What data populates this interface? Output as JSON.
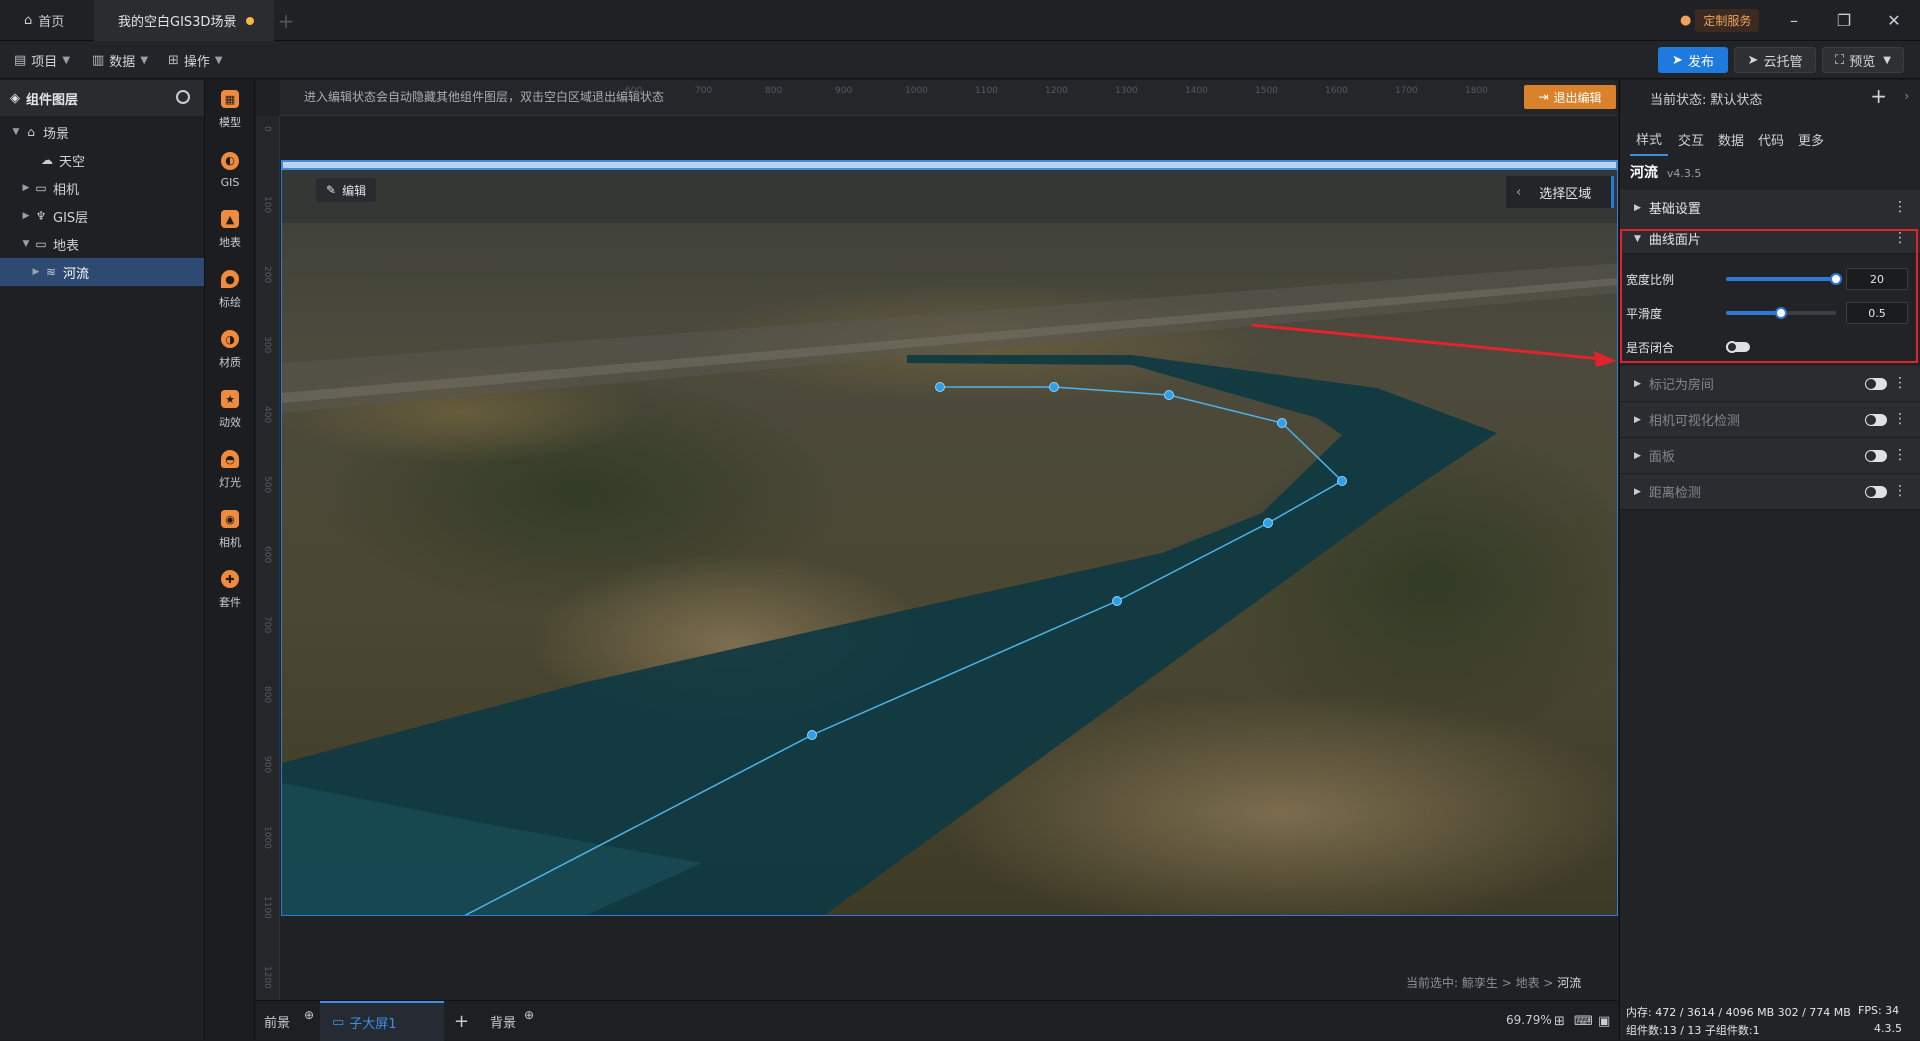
{
  "titlebar": {
    "home_tab": "首页",
    "scene_tab": "我的空白GIS3D场景",
    "custom_service": "定制服务"
  },
  "menubar": {
    "project": "项目",
    "data": "数据",
    "operate": "操作",
    "publish": "发布",
    "cloud": "云托管",
    "preview": "预览"
  },
  "layers": {
    "title": "组件图层",
    "items": [
      {
        "label": "场景"
      },
      {
        "label": "天空"
      },
      {
        "label": "相机"
      },
      {
        "label": "GIS层"
      },
      {
        "label": "地表"
      },
      {
        "label": "河流"
      }
    ]
  },
  "toolbox": {
    "items": [
      "模型",
      "GIS",
      "地表",
      "标绘",
      "材质",
      "动效",
      "灯光",
      "相机",
      "套件"
    ]
  },
  "canvas": {
    "notice": "进入编辑状态会自动隐藏其他组件图层，双击空白区域退出编辑状态",
    "exit_edit": "退出编辑",
    "edit_chip": "编辑",
    "select_area": "选择区域",
    "ruler_top": [
      "600",
      "700",
      "800",
      "900",
      "1000",
      "1100",
      "1200",
      "1300",
      "1400",
      "1500",
      "1600",
      "1700",
      "1800"
    ],
    "ruler_left": [
      "0",
      "100",
      "200",
      "300",
      "400",
      "500",
      "600",
      "700",
      "800",
      "900",
      "1000",
      "1100",
      "1200"
    ],
    "breadcrumb_prefix": "当前选中:",
    "breadcrumb": [
      "鲸孪生",
      "地表",
      "河流"
    ]
  },
  "bottombar": {
    "front": "前景",
    "sub_screen": "子大屏1",
    "background": "背景",
    "zoom": "69.79%"
  },
  "right_panel": {
    "state_label": "当前状态:",
    "state_value": "默认状态",
    "tabs": [
      "样式",
      "交互",
      "数据",
      "代码",
      "更多"
    ],
    "component_name": "河流",
    "component_version": "v4.3.5",
    "sections": {
      "basic": "基础设置",
      "curve": "曲线面片",
      "mark_room": "标记为房间",
      "camera_visibility": "相机可视化检测",
      "panel": "面板",
      "distance": "距离检测"
    },
    "props": {
      "width_ratio_label": "宽度比例",
      "width_ratio_value": "20",
      "width_ratio_fraction": 1.0,
      "smoothness_label": "平滑度",
      "smoothness_value": "0.5",
      "smoothness_fraction": 0.5,
      "closed_label": "是否闭合"
    },
    "stats": {
      "memory": "内存: 472 / 3614 / 4096 MB 302 / 774 MB",
      "fps": "FPS: 34",
      "components": "组件数:13 / 13  子组件数:1",
      "version": "4.3.5"
    }
  }
}
